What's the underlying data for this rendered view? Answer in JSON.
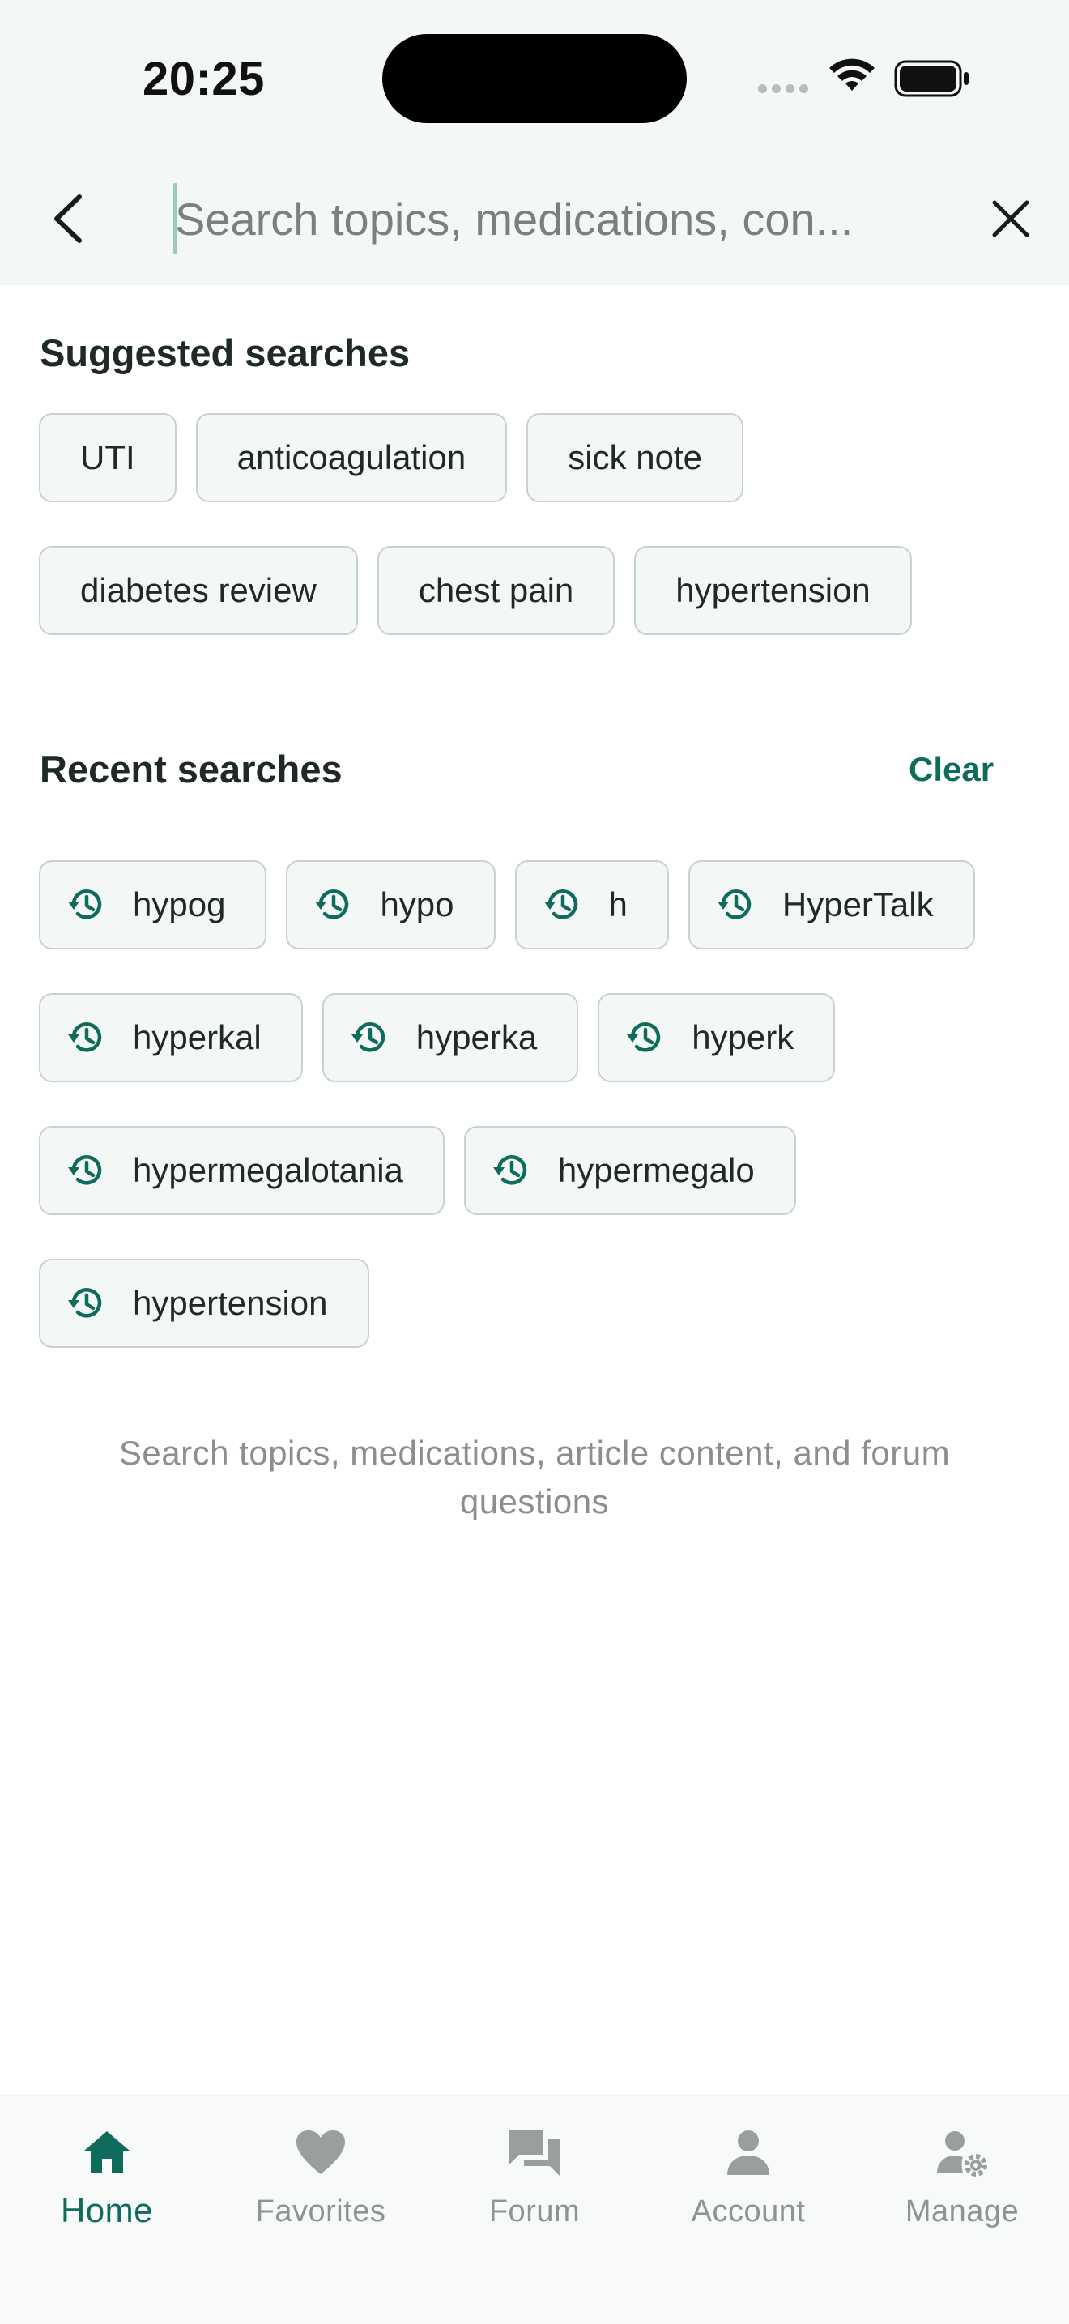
{
  "status_bar": {
    "time": "20:25"
  },
  "search": {
    "placeholder": "Search topics, medications, con..."
  },
  "suggested": {
    "title": "Suggested searches",
    "items": [
      "UTI",
      "anticoagulation",
      "sick note",
      "diabetes review",
      "chest pain",
      "hypertension"
    ]
  },
  "recent": {
    "title": "Recent searches",
    "clear_label": "Clear",
    "items": [
      "hypog",
      "hypo",
      "h",
      "HyperTalk",
      "hyperkal",
      "hyperka",
      "hyperk",
      "hypermegalotania",
      "hypermegalo",
      "hypertension"
    ],
    "icon": "history-icon"
  },
  "hint": "Search topics, medications, article content, and forum questions",
  "bottom_nav": {
    "items": [
      {
        "label": "Home",
        "icon": "home-icon",
        "active": true
      },
      {
        "label": "Favorites",
        "icon": "heart-icon",
        "active": false
      },
      {
        "label": "Forum",
        "icon": "forum-icon",
        "active": false
      },
      {
        "label": "Account",
        "icon": "person-icon",
        "active": false
      },
      {
        "label": "Manage",
        "icon": "manage-icon",
        "active": false
      }
    ]
  },
  "colors": {
    "accent": "#0f6b5c",
    "chip_bg": "#f3f8f6",
    "chip_border": "#c8d2cf",
    "muted": "#8f9493"
  }
}
